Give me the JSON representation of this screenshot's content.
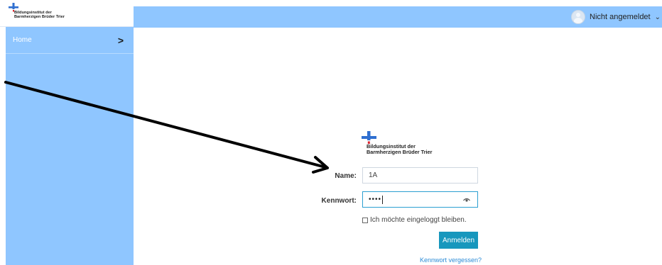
{
  "header": {
    "logo_line1": "Bildungsinstitut der",
    "logo_line2": "Barmherzigen Brüder Trier",
    "user_label": "Nicht angemeldet",
    "user_icon": "avatar-icon",
    "dropdown_icon": "chevron-down-icon"
  },
  "sidebar": {
    "items": [
      {
        "label": "Home",
        "icon": "chevron-right-icon"
      }
    ]
  },
  "login": {
    "logo_line1": "Bildungsinstitut der",
    "logo_line2": "Barmherzigen Brüder Trier",
    "name_label": "Name:",
    "name_value": "1A",
    "password_label": "Kennwort:",
    "password_value": "••••",
    "show_password_icon": "eye-icon",
    "remember_label": "Ich möchte eingeloggt bleiben.",
    "login_button": "Anmelden",
    "forgot_link": "Kennwort vergessen?"
  },
  "colors": {
    "sidebar_bg": "#8fc6ff",
    "button_bg": "#1797bd",
    "link": "#2b8bd6",
    "logo_blue": "#2f6fd0",
    "logo_red": "#d9232e"
  }
}
